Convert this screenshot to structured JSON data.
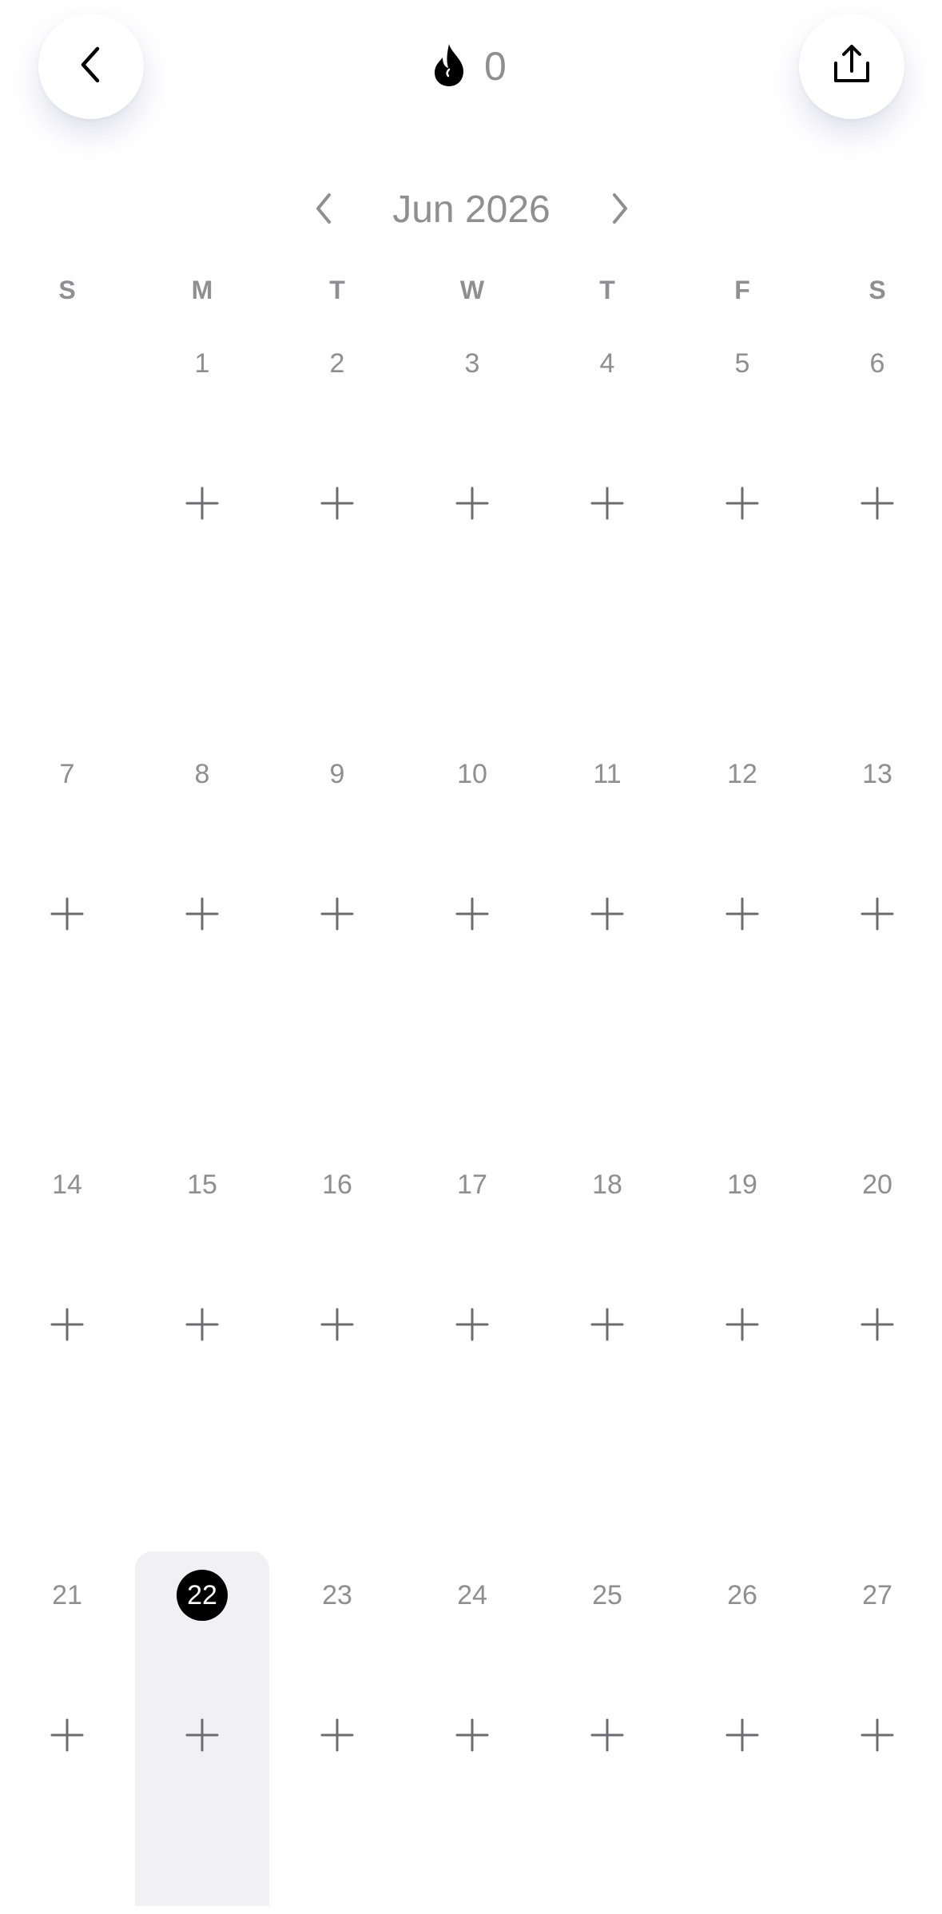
{
  "header": {
    "back_icon": "chevron-left-icon",
    "share_icon": "share-upload-icon",
    "streak_icon": "flame-icon",
    "streak_count": "0"
  },
  "calendar": {
    "month_label": "Jun 2026",
    "prev_icon": "chevron-left-icon",
    "next_icon": "chevron-right-icon",
    "weekdays": [
      "S",
      "M",
      "T",
      "W",
      "T",
      "F",
      "S"
    ],
    "weeks": [
      [
        "",
        "1",
        "2",
        "3",
        "4",
        "5",
        "6"
      ],
      [
        "7",
        "8",
        "9",
        "10",
        "11",
        "12",
        "13"
      ],
      [
        "14",
        "15",
        "16",
        "17",
        "18",
        "19",
        "20"
      ],
      [
        "21",
        "22",
        "23",
        "24",
        "25",
        "26",
        "27"
      ]
    ],
    "today": "22",
    "add_icon": "plus-icon",
    "colors": {
      "muted_text": "#8e8e93",
      "today_badge": "#000000",
      "today_column": "#f1f1f3"
    }
  }
}
